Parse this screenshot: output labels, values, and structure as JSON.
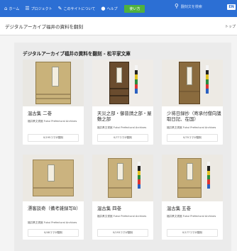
{
  "nav": {
    "home_label": "ホーム",
    "project_label": "プロジェクト",
    "about_label": "このサイトについて",
    "help_label": "ヘルプ",
    "how_label": "使い方",
    "search_placeholder": "翻刻文を検索",
    "lang_label": "EN"
  },
  "subheader": {
    "project_title": "デジタルアーカイブ福井の資料を翻刻",
    "top_link": "トップ"
  },
  "section": {
    "title": "デジタルアーカイブ福井の資料を翻刻 - 松平家文庫"
  },
  "cards": [
    {
      "title": "温古集 二巻",
      "archive": "福井県文書館 Fukui Prefectural Archives",
      "link": "0/195コマが翻刻"
    },
    {
      "title": "天災之部・御普請之部・屋敷之部",
      "archive": "福井県文書館 Fukui Prefectural Archives",
      "link": "0/77コマが翻刻"
    },
    {
      "title": "少将日録抄（寄承付僧向議取日記、在国）",
      "archive": "福井県文書館 Fukui Prefectural Archives",
      "link": "0/70コマが翻刻"
    },
    {
      "title": "漂客談奇（備考雑録写B）",
      "archive": "福井県文書館 Fukui Prefectural Archives",
      "link": "0/48コマが翻刻"
    },
    {
      "title": "温古集 四巻",
      "archive": "福井県文書館 Fukui Prefectural Archives",
      "link": "0/193コマが翻刻"
    },
    {
      "title": "温古集 五巻",
      "archive": "福井県文書館 Fukui Prefectural Archives",
      "link": "0/177コマが翻刻"
    }
  ]
}
